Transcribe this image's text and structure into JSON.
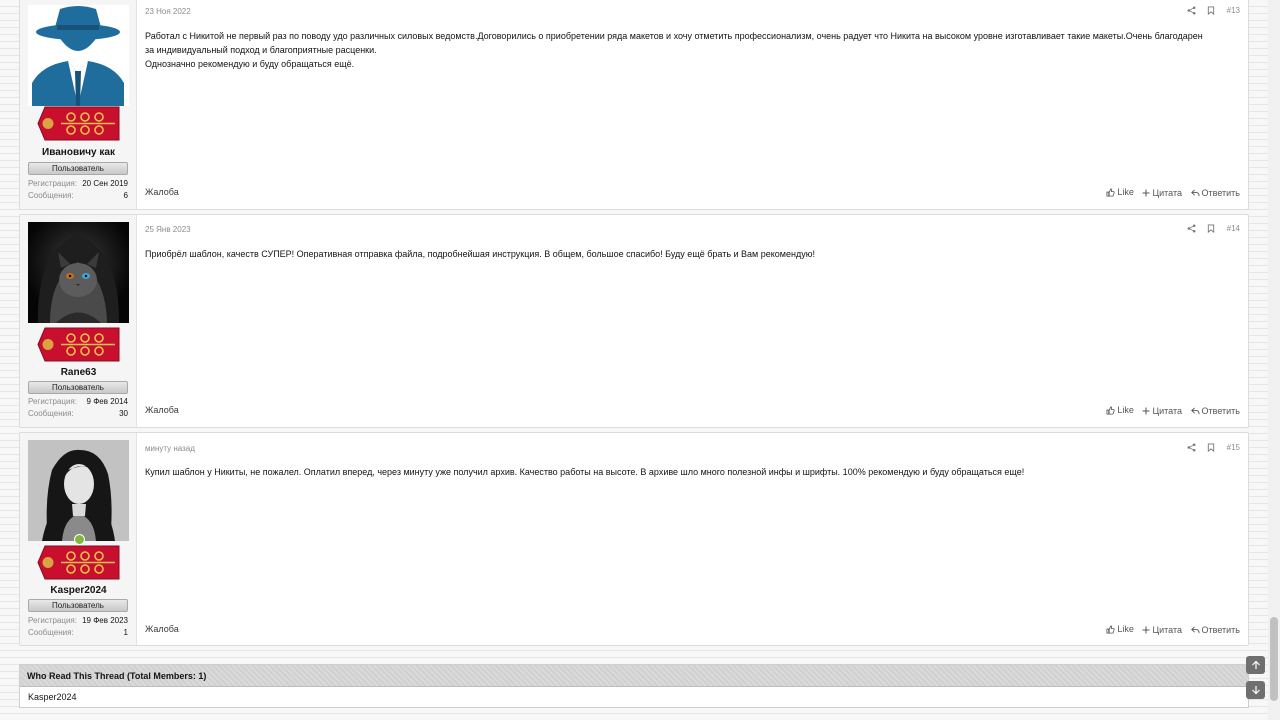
{
  "posts": [
    {
      "username": "Ивановичу как",
      "user_title": "Пользователь",
      "reg_label": "Регистрация:",
      "reg_value": "20 Сен 2019",
      "msg_label": "Сообщения:",
      "msg_value": "6",
      "date": "23 Ноя 2022",
      "number": "#13",
      "body": [
        "Работал с Никитой не первый раз по поводу удо различных силовых ведомств.Договорились о приобретении ряда макетов и хочу отметить профессионализм, очень радует что Никита на высоком уровне изготавливает такие макеты.Очень благодарен",
        "за индивидуальный подход и благоприятные расценки.",
        "Однозначно рекомендую и буду обращаться ещё."
      ],
      "report": "Жалоба",
      "like": "Like",
      "quote": "Цитата",
      "reply": "Ответить"
    },
    {
      "username": "Rane63",
      "user_title": "Пользователь",
      "reg_label": "Регистрация:",
      "reg_value": "9 Фев 2014",
      "msg_label": "Сообщения:",
      "msg_value": "30",
      "date": "25 Янв 2023",
      "number": "#14",
      "body": [
        "Приобрёл шаблон, качеств СУПЕР! Оперативная отправка файла, подробнейшая инструкция. В общем, большое спасибо! Буду ещё брать и Вам рекомендую!"
      ],
      "report": "Жалоба",
      "like": "Like",
      "quote": "Цитата",
      "reply": "Ответить"
    },
    {
      "username": "Kasper2024",
      "user_title": "Пользователь",
      "reg_label": "Регистрация:",
      "reg_value": "19 Фев 2023",
      "msg_label": "Сообщения:",
      "msg_value": "1",
      "date": "минуту назад",
      "number": "#15",
      "body": [
        "Купил шаблон у Никиты, не пожалел. Оплатил вперед, через минуту уже получил архив. Качество работы на высоте. В архиве шло много полезной инфы и шрифты. 100% рекомендую и буду обращаться еще!"
      ],
      "report": "Жалоба",
      "like": "Like",
      "quote": "Цитата",
      "reply": "Ответить"
    }
  ],
  "who_read": {
    "title": "Who Read This Thread (Total Members: 1)",
    "members": "Kasper2024"
  },
  "icons": {
    "share": "share-icon",
    "bookmark": "bookmark-icon",
    "like": "thumbs-up-icon",
    "quote": "plus-icon",
    "reply": "reply-icon",
    "scroll_up": "arrow-up-icon",
    "scroll_down": "arrow-down-icon",
    "online": "online-status-icon"
  },
  "colors": {
    "accent": "#1d6fa5",
    "online": "#7fb93a",
    "badge": "#c8102e"
  }
}
